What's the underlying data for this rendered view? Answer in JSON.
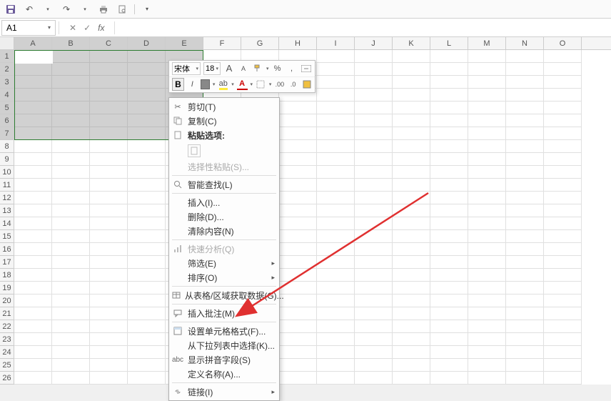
{
  "quickAccess": {
    "save": "💾"
  },
  "nameBox": {
    "value": "A1"
  },
  "formulaBar": {
    "fx": "fx"
  },
  "columns": [
    "A",
    "B",
    "C",
    "D",
    "E",
    "F",
    "G",
    "H",
    "I",
    "J",
    "K",
    "L",
    "M",
    "N",
    "O"
  ],
  "rowCount": 26,
  "selection": {
    "cols": 5,
    "rows": 7
  },
  "miniToolbar": {
    "font": "宋体",
    "size": "18",
    "increaseFont": "A",
    "decreaseFont": "A",
    "percent": "%",
    "comma": ",",
    "bold": "B",
    "italic": "I",
    "fontColorA": "A"
  },
  "contextMenu": {
    "cut": "剪切(T)",
    "copy": "复制(C)",
    "pasteOptionsHeader": "粘贴选项:",
    "pasteSpecial": "选择性粘贴(S)...",
    "smartLookup": "智能查找(L)",
    "insert": "插入(I)...",
    "delete": "删除(D)...",
    "clearContents": "清除内容(N)",
    "quickAnalysis": "快速分析(Q)",
    "filter": "筛选(E)",
    "sort": "排序(O)",
    "getDataFromTable": "从表格/区域获取数据(G)...",
    "insertComment": "插入批注(M)",
    "formatCells": "设置单元格格式(F)...",
    "pickFromList": "从下拉列表中选择(K)...",
    "showPhonetic": "显示拼音字段(S)",
    "defineName": "定义名称(A)...",
    "hyperlink": "链接(I)"
  }
}
